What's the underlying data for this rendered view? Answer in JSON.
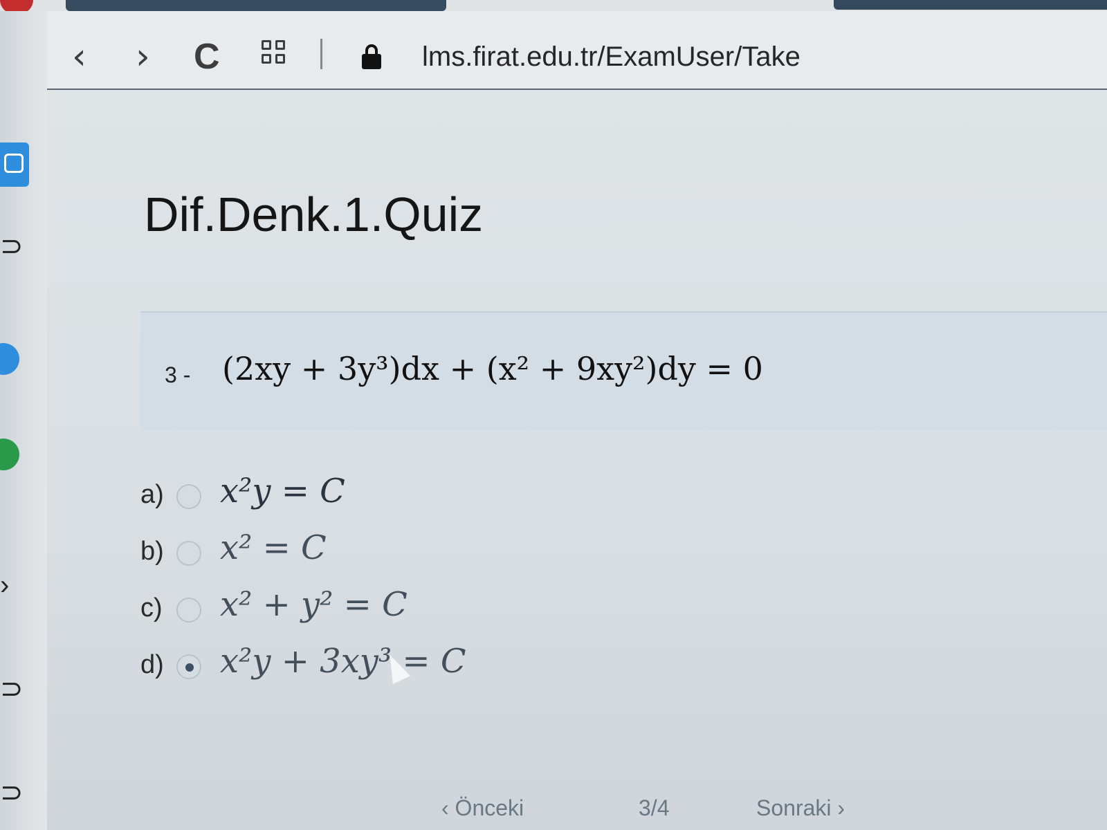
{
  "browser": {
    "url": "lms.firat.edu.tr/ExamUser/Take",
    "back_icon": "‹",
    "forward_icon": "›",
    "reload_icon": "C"
  },
  "page": {
    "title": "Dif.Denk.1.Quiz"
  },
  "question": {
    "number": "3 -",
    "equation": "(2xy + 3y³)dx + (x² + 9xy²)dy = 0"
  },
  "options": [
    {
      "letter": "a)",
      "text": "x²y = C",
      "selected": false
    },
    {
      "letter": "b)",
      "text": "x² = C",
      "selected": false
    },
    {
      "letter": "c)",
      "text": "x² + y² = C",
      "selected": false
    },
    {
      "letter": "d)",
      "text": "x²y + 3xy³ = C",
      "selected": true
    }
  ],
  "navigation": {
    "previous": "‹ Önceki",
    "progress": "3/4",
    "next": "Sonraki ›"
  },
  "colors": {
    "accent": "#2e8ddd",
    "background": "#d9dfe3"
  }
}
